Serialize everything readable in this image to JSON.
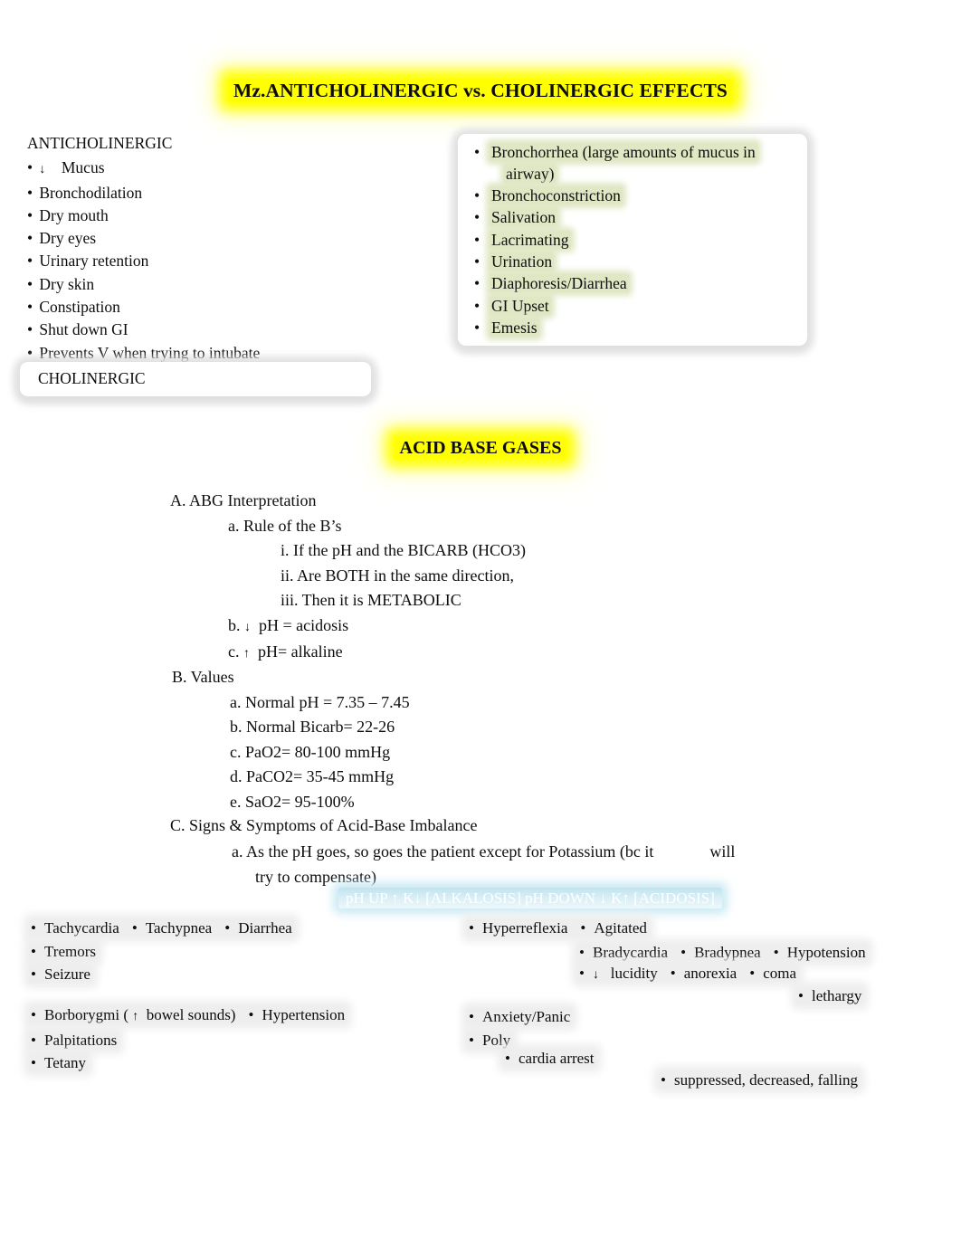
{
  "document": {
    "title": "Mz.ANTICHOLINERGIC vs. CHOLINERGIC EFFECTS",
    "section_title": "ACID BASE GASES"
  },
  "colors": {
    "highlight_yellow": "#ffff00",
    "highlight_green": "#dfe7c4",
    "highlight_gray": "#eeeeee",
    "highlight_cyan": "#bfe3ef",
    "text": "#0d0d0d"
  },
  "anticholinergic": {
    "heading": "ANTICHOLINERGIC",
    "items": [
      {
        "arrow": "↓",
        "text": "Mucus"
      },
      {
        "arrow": "",
        "text": "Bronchodilation"
      },
      {
        "arrow": "",
        "text": "Dry mouth"
      },
      {
        "arrow": "",
        "text": "Dry eyes"
      },
      {
        "arrow": "",
        "text": "Urinary retention"
      },
      {
        "arrow": "",
        "text": "Dry skin"
      },
      {
        "arrow": "",
        "text": "Constipation"
      },
      {
        "arrow": "",
        "text": "Shut down GI"
      },
      {
        "arrow": "",
        "text": "Prevents V when trying to intubate"
      }
    ]
  },
  "cholinergic": {
    "heading": "CHOLINERGIC",
    "items": [
      {
        "text": "Bronchorrhea (large amounts of mucus in",
        "continuation": "airway)"
      },
      {
        "text": "Bronchoconstriction",
        "continuation": ""
      },
      {
        "text": "Salivation",
        "continuation": ""
      },
      {
        "text": "Lacrimating",
        "continuation": ""
      },
      {
        "text": "Urination",
        "continuation": ""
      },
      {
        "text": "Diaphoresis/Diarrhea",
        "continuation": ""
      },
      {
        "text": "GI Upset",
        "continuation": ""
      },
      {
        "text": "Emesis",
        "continuation": ""
      }
    ]
  },
  "acid_base": {
    "section_a": {
      "label": "A. ABG Interpretation",
      "sub_a": "a. Rule of the B’s",
      "sub_a_items": [
        "i. If the pH and the BICARB (HCO3)",
        "ii. Are BOTH in the same direction,",
        "iii. Then it is METABOLIC"
      ],
      "sub_b_prefix": "b.",
      "sub_b_arrow": "↓",
      "sub_b_text": "pH = acidosis",
      "sub_c_prefix": "c.",
      "sub_c_arrow": "↑",
      "sub_c_text": "pH= alkaline"
    },
    "section_b": {
      "label": "B. Values",
      "items": [
        "a. Normal pH = 7.35 – 7.45",
        "b. Normal Bicarb= 22-26",
        "c. PaO2= 80-100 mmHg",
        "d. PaCO2= 35-45 mmHg",
        "e. SaO2= 95-100%"
      ]
    },
    "section_c": {
      "label": "C. Signs & Symptoms of Acid-Base Imbalance",
      "note_line1_start": "a. As the pH goes, so goes the patient except for Potassium (bc it",
      "note_line1_end": "will",
      "note_line2": "try to compensate)",
      "ph_k_line": "pH UP  ↑   K↓   [ALKALOSIS] pH DOWN  ↓   K↑   [ACIDOSIS]"
    }
  },
  "symptoms": {
    "alkalosis_group": {
      "row1": [
        "Tachycardia",
        "Tachypnea",
        "Diarrhea"
      ],
      "row2": [
        "Tremors"
      ],
      "row3": [
        "Seizure"
      ],
      "row4_first": "Borborygmi (",
      "row4_arrow": "↑",
      "row4_rest": "bowel sounds)",
      "row4_second": "Hypertension",
      "row5": [
        "Palpitations"
      ],
      "row6": [
        "Tetany"
      ]
    },
    "acidosis_group": {
      "row1": [
        "Hyperreflexia",
        "Agitated"
      ],
      "row2": [
        "Bradycardia",
        "Bradypnea",
        "Hypotension"
      ],
      "row3_arrow": "↓",
      "row3": [
        "lucidity",
        "anorexia",
        "coma"
      ],
      "row4": [
        "lethargy"
      ],
      "row5": [
        "Anxiety/Panic"
      ],
      "row6": [
        "Poly"
      ],
      "row7": [
        "cardia arrest"
      ],
      "row8": [
        "suppressed, decreased, falling"
      ]
    }
  }
}
